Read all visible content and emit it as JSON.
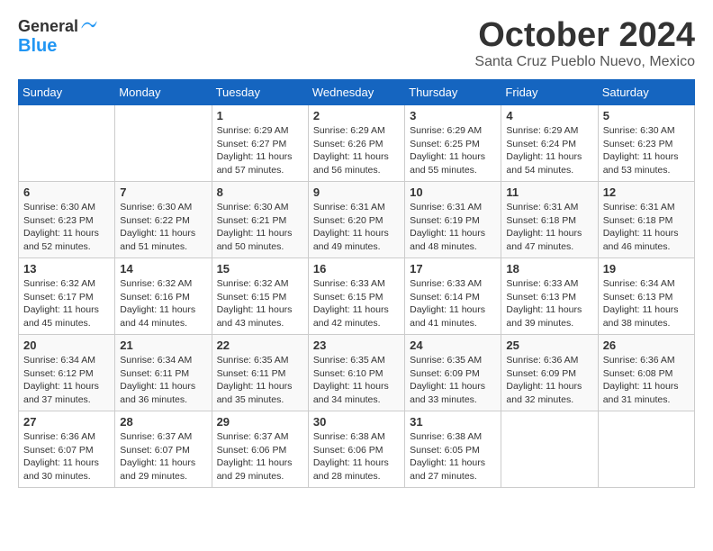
{
  "header": {
    "logo_line1": "General",
    "logo_line2": "Blue",
    "month": "October 2024",
    "location": "Santa Cruz Pueblo Nuevo, Mexico"
  },
  "weekdays": [
    "Sunday",
    "Monday",
    "Tuesday",
    "Wednesday",
    "Thursday",
    "Friday",
    "Saturday"
  ],
  "weeks": [
    [
      {
        "day": "",
        "info": ""
      },
      {
        "day": "",
        "info": ""
      },
      {
        "day": "1",
        "info": "Sunrise: 6:29 AM\nSunset: 6:27 PM\nDaylight: 11 hours and 57 minutes."
      },
      {
        "day": "2",
        "info": "Sunrise: 6:29 AM\nSunset: 6:26 PM\nDaylight: 11 hours and 56 minutes."
      },
      {
        "day": "3",
        "info": "Sunrise: 6:29 AM\nSunset: 6:25 PM\nDaylight: 11 hours and 55 minutes."
      },
      {
        "day": "4",
        "info": "Sunrise: 6:29 AM\nSunset: 6:24 PM\nDaylight: 11 hours and 54 minutes."
      },
      {
        "day": "5",
        "info": "Sunrise: 6:30 AM\nSunset: 6:23 PM\nDaylight: 11 hours and 53 minutes."
      }
    ],
    [
      {
        "day": "6",
        "info": "Sunrise: 6:30 AM\nSunset: 6:23 PM\nDaylight: 11 hours and 52 minutes."
      },
      {
        "day": "7",
        "info": "Sunrise: 6:30 AM\nSunset: 6:22 PM\nDaylight: 11 hours and 51 minutes."
      },
      {
        "day": "8",
        "info": "Sunrise: 6:30 AM\nSunset: 6:21 PM\nDaylight: 11 hours and 50 minutes."
      },
      {
        "day": "9",
        "info": "Sunrise: 6:31 AM\nSunset: 6:20 PM\nDaylight: 11 hours and 49 minutes."
      },
      {
        "day": "10",
        "info": "Sunrise: 6:31 AM\nSunset: 6:19 PM\nDaylight: 11 hours and 48 minutes."
      },
      {
        "day": "11",
        "info": "Sunrise: 6:31 AM\nSunset: 6:18 PM\nDaylight: 11 hours and 47 minutes."
      },
      {
        "day": "12",
        "info": "Sunrise: 6:31 AM\nSunset: 6:18 PM\nDaylight: 11 hours and 46 minutes."
      }
    ],
    [
      {
        "day": "13",
        "info": "Sunrise: 6:32 AM\nSunset: 6:17 PM\nDaylight: 11 hours and 45 minutes."
      },
      {
        "day": "14",
        "info": "Sunrise: 6:32 AM\nSunset: 6:16 PM\nDaylight: 11 hours and 44 minutes."
      },
      {
        "day": "15",
        "info": "Sunrise: 6:32 AM\nSunset: 6:15 PM\nDaylight: 11 hours and 43 minutes."
      },
      {
        "day": "16",
        "info": "Sunrise: 6:33 AM\nSunset: 6:15 PM\nDaylight: 11 hours and 42 minutes."
      },
      {
        "day": "17",
        "info": "Sunrise: 6:33 AM\nSunset: 6:14 PM\nDaylight: 11 hours and 41 minutes."
      },
      {
        "day": "18",
        "info": "Sunrise: 6:33 AM\nSunset: 6:13 PM\nDaylight: 11 hours and 39 minutes."
      },
      {
        "day": "19",
        "info": "Sunrise: 6:34 AM\nSunset: 6:13 PM\nDaylight: 11 hours and 38 minutes."
      }
    ],
    [
      {
        "day": "20",
        "info": "Sunrise: 6:34 AM\nSunset: 6:12 PM\nDaylight: 11 hours and 37 minutes."
      },
      {
        "day": "21",
        "info": "Sunrise: 6:34 AM\nSunset: 6:11 PM\nDaylight: 11 hours and 36 minutes."
      },
      {
        "day": "22",
        "info": "Sunrise: 6:35 AM\nSunset: 6:11 PM\nDaylight: 11 hours and 35 minutes."
      },
      {
        "day": "23",
        "info": "Sunrise: 6:35 AM\nSunset: 6:10 PM\nDaylight: 11 hours and 34 minutes."
      },
      {
        "day": "24",
        "info": "Sunrise: 6:35 AM\nSunset: 6:09 PM\nDaylight: 11 hours and 33 minutes."
      },
      {
        "day": "25",
        "info": "Sunrise: 6:36 AM\nSunset: 6:09 PM\nDaylight: 11 hours and 32 minutes."
      },
      {
        "day": "26",
        "info": "Sunrise: 6:36 AM\nSunset: 6:08 PM\nDaylight: 11 hours and 31 minutes."
      }
    ],
    [
      {
        "day": "27",
        "info": "Sunrise: 6:36 AM\nSunset: 6:07 PM\nDaylight: 11 hours and 30 minutes."
      },
      {
        "day": "28",
        "info": "Sunrise: 6:37 AM\nSunset: 6:07 PM\nDaylight: 11 hours and 29 minutes."
      },
      {
        "day": "29",
        "info": "Sunrise: 6:37 AM\nSunset: 6:06 PM\nDaylight: 11 hours and 29 minutes."
      },
      {
        "day": "30",
        "info": "Sunrise: 6:38 AM\nSunset: 6:06 PM\nDaylight: 11 hours and 28 minutes."
      },
      {
        "day": "31",
        "info": "Sunrise: 6:38 AM\nSunset: 6:05 PM\nDaylight: 11 hours and 27 minutes."
      },
      {
        "day": "",
        "info": ""
      },
      {
        "day": "",
        "info": ""
      }
    ]
  ]
}
